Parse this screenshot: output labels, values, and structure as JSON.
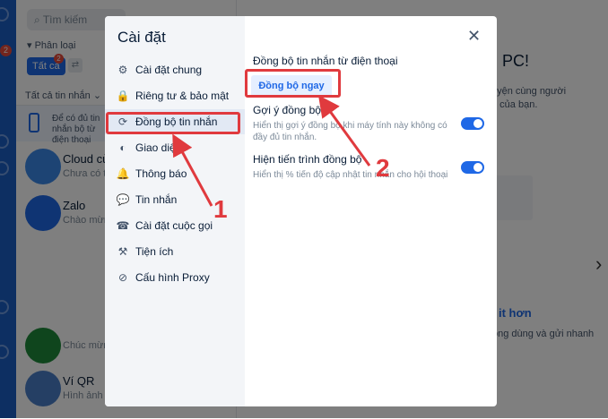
{
  "background": {
    "search_placeholder": "Tìm kiếm",
    "filter_label": "Phân loại",
    "tab_all": "Tất cả",
    "tab_all_badge": "2",
    "rail_badge": "2",
    "list_header": "Tất cả tin nhắn",
    "sync_note": "Để có đủ tin nhắn bộ từ điện thoại",
    "conversations": [
      {
        "name": "Cloud củ",
        "sub": "Chưa có tin"
      },
      {
        "name": "Zalo",
        "sub": "Chào mừng"
      },
      {
        "name": "",
        "sub": "Chúc mừng"
      },
      {
        "name": "Ví QR",
        "sub": "Hình ảnh"
      }
    ],
    "main_title": "PC!",
    "main_text": "uyện cùng người\nn của bạn.",
    "main_link": "it hơn",
    "main_text2": "ông dùng và gửi nhanh"
  },
  "modal": {
    "title": "Cài đặt",
    "menu": [
      {
        "icon": "gear-icon",
        "glyph": "⚙",
        "label": "Cài đặt chung"
      },
      {
        "icon": "lock-icon",
        "glyph": "🔒",
        "label": "Riêng tư & bảo mật"
      },
      {
        "icon": "sync-icon",
        "glyph": "⟳",
        "label": "Đồng bộ tin nhắn"
      },
      {
        "icon": "palette-icon",
        "glyph": "◐",
        "label": "Giao diện"
      },
      {
        "icon": "bell-icon",
        "glyph": "🔔",
        "label": "Thông báo"
      },
      {
        "icon": "message-icon",
        "glyph": "💬",
        "label": "Tin nhắn"
      },
      {
        "icon": "phone-icon",
        "glyph": "☎",
        "label": "Cài đặt cuộc gọi"
      },
      {
        "icon": "tools-icon",
        "glyph": "⚒",
        "label": "Tiện ích"
      },
      {
        "icon": "proxy-icon",
        "glyph": "⊘",
        "label": "Cấu hình Proxy"
      }
    ],
    "active_index": 2,
    "section_title": "Đồng bộ tin nhắn từ điện thoại",
    "sync_button": "Đồng bộ ngay",
    "options": [
      {
        "title": "Gợi ý đồng bộ",
        "desc": "Hiển thị gợi ý đồng bộ khi máy tính này không có đầy đủ tin nhắn.",
        "enabled": true
      },
      {
        "title": "Hiện tiến trình đồng bộ",
        "desc": "Hiển thị % tiến độ cập nhật tin nhắn cho hội thoại",
        "enabled": true
      }
    ]
  },
  "annotations": {
    "step1": "1",
    "step2": "2",
    "color": "#e03a3e"
  }
}
